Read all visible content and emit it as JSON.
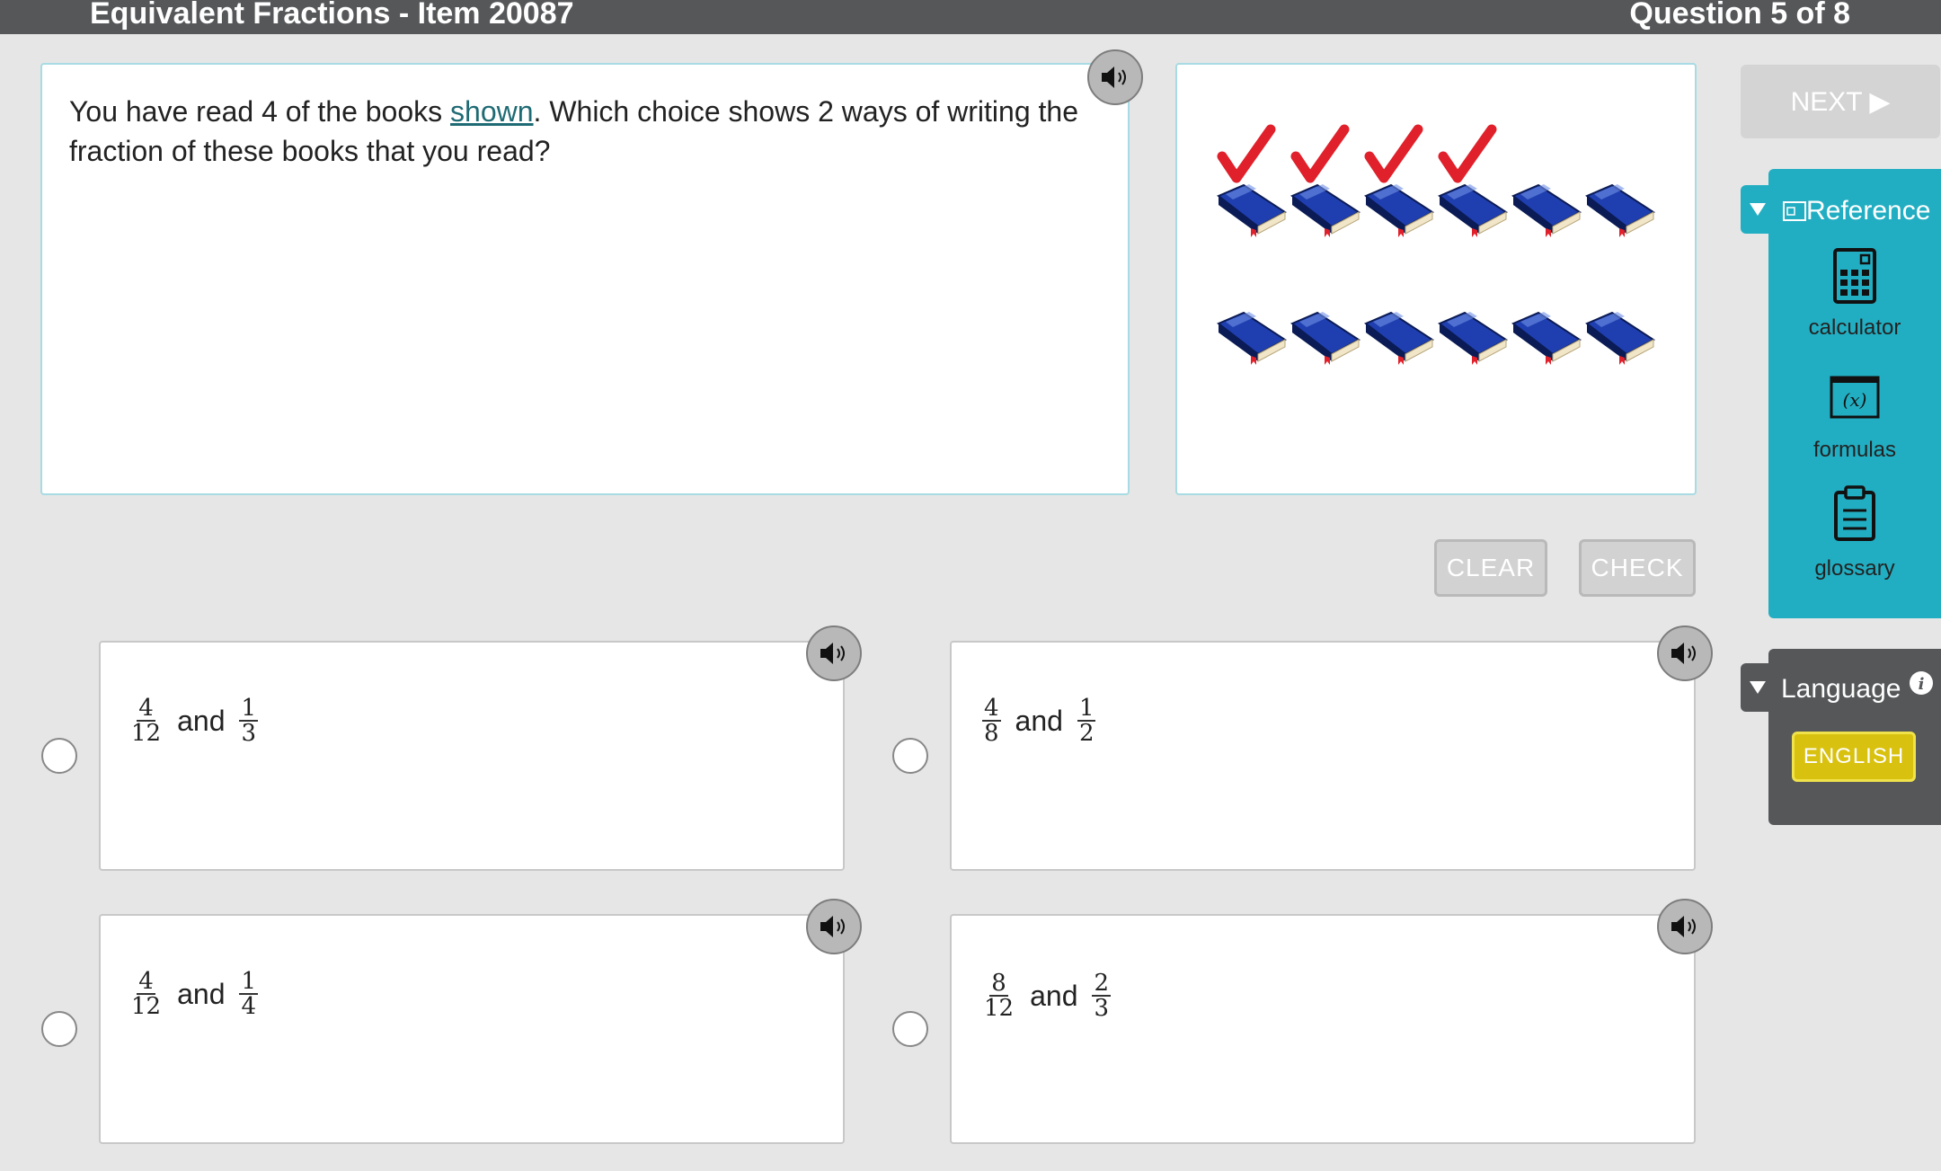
{
  "header": {
    "title": "Equivalent Fractions - Item 20087",
    "question_counter": "Question 5 of 8"
  },
  "question": {
    "text_before": "You have read 4 of the books ",
    "link_text": "shown",
    "text_after": ". Which choice shows 2 ways of writing the fraction of these books that you read?"
  },
  "figure": {
    "books_total": 12,
    "books_checked": 4,
    "book_color": "#1f3fb0",
    "check_color": "#e0202a"
  },
  "controls": {
    "clear_label": "CLEAR",
    "check_label": "CHECK",
    "next_label": "NEXT ▶"
  },
  "choices": [
    {
      "a_num": "4",
      "a_den": "12",
      "word": "and",
      "b_num": "1",
      "b_den": "3"
    },
    {
      "a_num": "4",
      "a_den": "8",
      "word": "and",
      "b_num": "1",
      "b_den": "2"
    },
    {
      "a_num": "4",
      "a_den": "12",
      "word": "and",
      "b_num": "1",
      "b_den": "4"
    },
    {
      "a_num": "8",
      "a_den": "12",
      "word": "and",
      "b_num": "2",
      "b_den": "3"
    }
  ],
  "reference": {
    "title": "Reference",
    "tools": [
      {
        "label": "calculator",
        "icon": "calculator-icon"
      },
      {
        "label": "formulas",
        "icon": "formulas-icon"
      },
      {
        "label": "glossary",
        "icon": "clipboard-icon"
      }
    ]
  },
  "language": {
    "title": "Language",
    "info_icon": "info-icon",
    "selected": "ENGLISH"
  },
  "colors": {
    "header_bg": "#555759",
    "reference_bg": "#22aec2",
    "language_bg": "#555759",
    "english_button": "#d9c10f"
  }
}
